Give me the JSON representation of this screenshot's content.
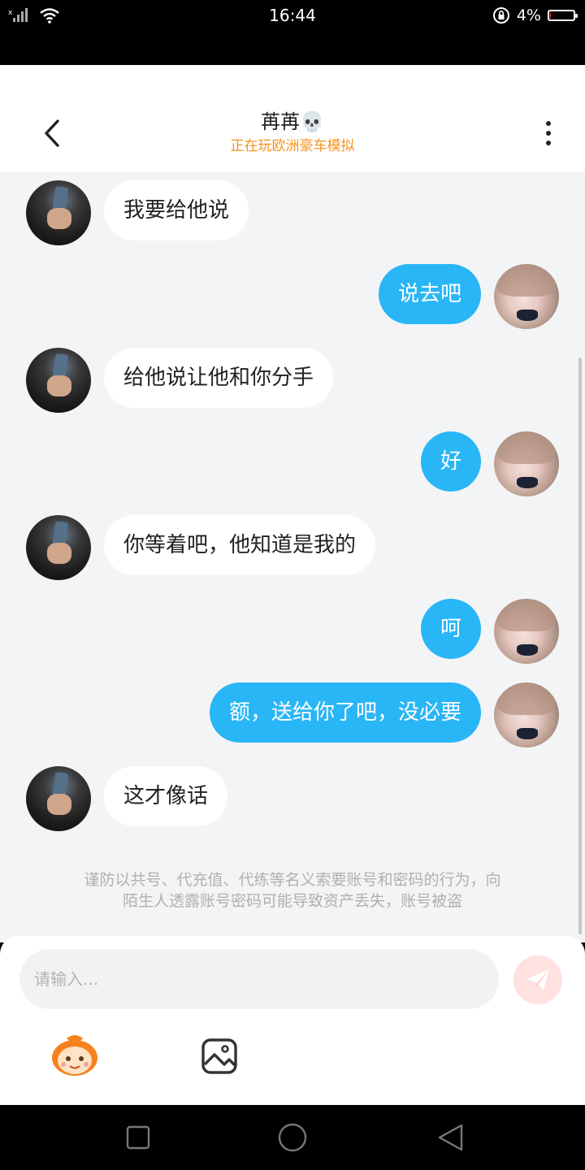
{
  "status_bar": {
    "time": "16:44",
    "battery_text": "4%",
    "battery_level": 0.04,
    "battery_color": "#e53935"
  },
  "header": {
    "title": "苒苒💀",
    "subtitle": "正在玩欧洲豪车模拟",
    "subtitle_color": "#f5921f"
  },
  "messages": [
    {
      "side": "in",
      "text": "我要给他说"
    },
    {
      "side": "out",
      "text": "说去吧"
    },
    {
      "side": "in",
      "text": "给他说让他和你分手"
    },
    {
      "side": "out",
      "text": "好"
    },
    {
      "side": "in",
      "text": "你等着吧，他知道是我的"
    },
    {
      "side": "out",
      "text": "呵"
    },
    {
      "side": "out",
      "text": "额，送给你了吧，没必要"
    },
    {
      "side": "in",
      "text": "这才像话"
    }
  ],
  "notice": {
    "line1": "谨防以共号、代充值、代练等名义索要账号和密码的行为，向",
    "line2": "陌生人透露账号密码可能导致资产丢失，账号被盗"
  },
  "composer": {
    "placeholder": "请输入..."
  },
  "colors": {
    "outgoing_bubble": "#29b6f6",
    "incoming_bubble": "#ffffff",
    "chat_background": "#f3f4f6",
    "send_button": "#ffe1df"
  },
  "icons": {
    "back": "chevron-left-icon",
    "more": "more-vertical-icon",
    "send": "paper-plane-icon",
    "emoji": "mascot-emoji-icon",
    "image": "image-icon"
  }
}
